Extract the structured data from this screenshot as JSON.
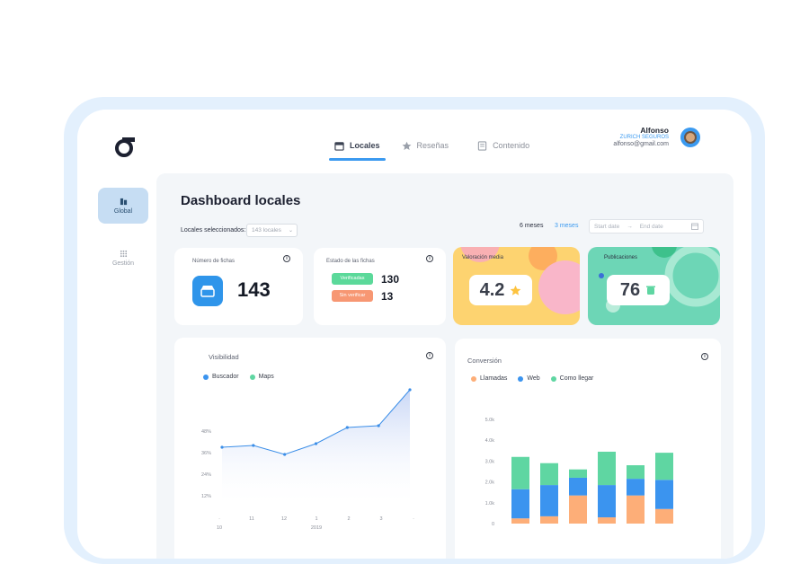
{
  "header": {
    "nav": [
      {
        "label": "Locales",
        "active": true
      },
      {
        "label": "Reseñas",
        "active": false
      },
      {
        "label": "Contenido",
        "active": false
      }
    ],
    "user": {
      "name": "Alfonso",
      "company": "ZURICH SEGUROS",
      "email": "alfonso@gmail.com"
    }
  },
  "sidebar": {
    "items": [
      {
        "label": "Global",
        "active": true
      },
      {
        "label": "Gestión",
        "active": false
      }
    ]
  },
  "main": {
    "title": "Dashboard locales",
    "selector_label": "Locales seleccionados:",
    "selector_value": "143 locales",
    "range_6": "6 meses",
    "range_3": "3 meses",
    "start_date_placeholder": "Start date",
    "end_date_placeholder": "End date",
    "arrow": "→"
  },
  "cards": {
    "fichas": {
      "label": "Número de fichas",
      "value": "143"
    },
    "estado": {
      "label": "Estado de las fichas",
      "verified_label": "Verificadas",
      "verified_value": "130",
      "unverified_label": "Sin verificar",
      "unverified_value": "13"
    },
    "valoracion": {
      "label": "Valoración media",
      "value": "4.2"
    },
    "publicaciones": {
      "label": "Publicaciones",
      "value": "76"
    }
  },
  "colors": {
    "accent": "#3b9af0",
    "llamadas": "#fdae78",
    "web": "#3b94ef",
    "como_llegar": "#5fd6a2"
  },
  "chart_data": [
    {
      "type": "area",
      "title": "Visibilidad",
      "series": [
        {
          "name": "Buscador",
          "color": "#3b94ef"
        },
        {
          "name": "Maps",
          "color": "#5fd6a2"
        }
      ],
      "x": [
        "10",
        "",
        "11",
        "",
        "12",
        "",
        "1",
        "",
        "2",
        "",
        "3",
        "4"
      ],
      "x_ticks": [
        "·",
        "11",
        "12",
        "1",
        "2",
        "3",
        "·"
      ],
      "x_sub": [
        "10",
        "2019"
      ],
      "y_ticks": [
        "12%",
        "24%",
        "36%",
        "48%"
      ],
      "values": [
        29,
        30,
        25,
        31,
        40,
        41,
        61
      ],
      "ylim": [
        0,
        60
      ]
    },
    {
      "type": "bar",
      "stacked": true,
      "title": "Conversión",
      "series": [
        {
          "name": "Llamadas",
          "color": "#fdae78",
          "values": [
            250,
            350,
            1350,
            300,
            1350,
            700
          ]
        },
        {
          "name": "Web",
          "color": "#3b94ef",
          "values": [
            1400,
            1500,
            850,
            1550,
            800,
            1400
          ]
        },
        {
          "name": "Como llegar",
          "color": "#5fd6a2",
          "values": [
            1550,
            1050,
            400,
            1600,
            650,
            1300
          ]
        }
      ],
      "y_ticks": [
        "0",
        "1.0k",
        "2.0k",
        "3.0k",
        "4.0k",
        "5.0k"
      ],
      "ylim": [
        0,
        5000
      ]
    }
  ]
}
